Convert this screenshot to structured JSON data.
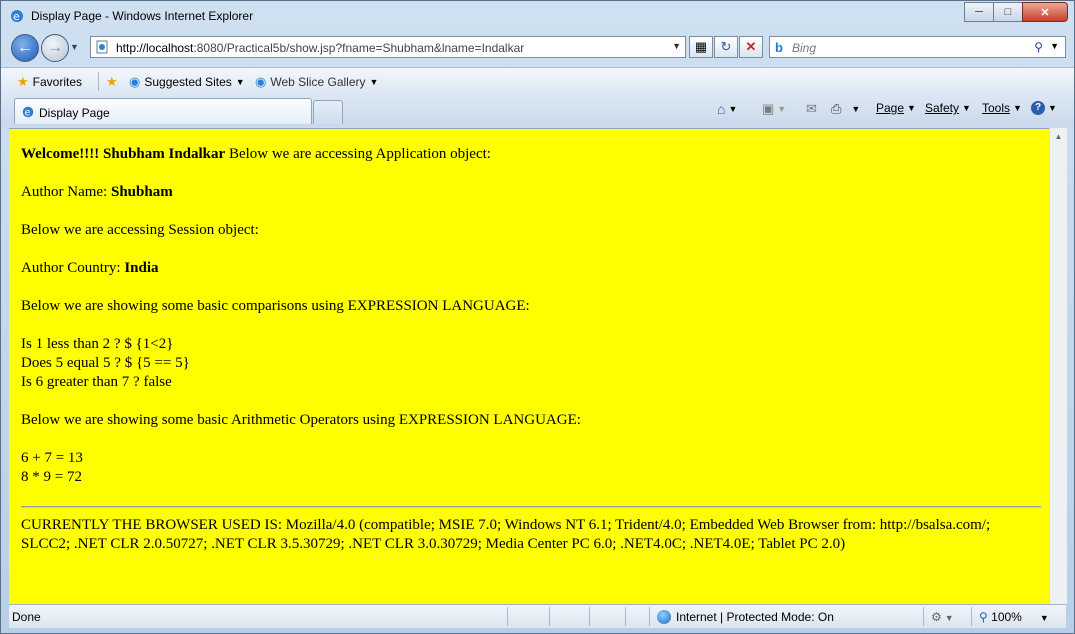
{
  "window": {
    "title": "Display Page - Windows Internet Explorer"
  },
  "address": {
    "url_host": "http://localhost",
    "url_rest": ":8080/Practical5b/show.jsp?fname=Shubham&lname=Indalkar"
  },
  "search": {
    "placeholder": "Bing"
  },
  "favorites": {
    "favorites_label": "Favorites",
    "suggested_label": "Suggested Sites",
    "webslice_label": "Web Slice Gallery"
  },
  "tab": {
    "title": "Display Page"
  },
  "commandbar": {
    "page": "Page",
    "safety": "Safety",
    "tools": "Tools"
  },
  "content": {
    "welcome_bold": "Welcome!!!! Shubham Indalkar",
    "welcome_rest": " Below we are accessing Application object:",
    "author_name_label": "Author Name: ",
    "author_name_value": "Shubham",
    "session_line": "Below we are accessing Session object:",
    "author_country_label": "Author Country: ",
    "author_country_value": "India",
    "comparisons_heading": "Below we are showing some basic comparisons using EXPRESSION LANGUAGE:",
    "comparisons": [
      "Is 1 less than 2 ? $ {1<2}",
      "Does 5 equal 5 ? $ {5 == 5}",
      "Is 6 greater than 7 ? false"
    ],
    "arithmetic_heading": "Below we are showing some basic Arithmetic Operators using EXPRESSION LANGUAGE:",
    "arithmetic": [
      "6 + 7 = 13",
      "8 * 9 = 72"
    ],
    "browser_line": "CURRENTLY THE BROWSER USED IS: Mozilla/4.0 (compatible; MSIE 7.0; Windows NT 6.1; Trident/4.0; Embedded Web Browser from: http://bsalsa.com/; SLCC2; .NET CLR 2.0.50727; .NET CLR 3.5.30729; .NET CLR 3.0.30729; Media Center PC 6.0; .NET4.0C; .NET4.0E; Tablet PC 2.0)"
  },
  "status": {
    "left": "Done",
    "zone": "Internet | Protected Mode: On",
    "zoom": "100%"
  }
}
